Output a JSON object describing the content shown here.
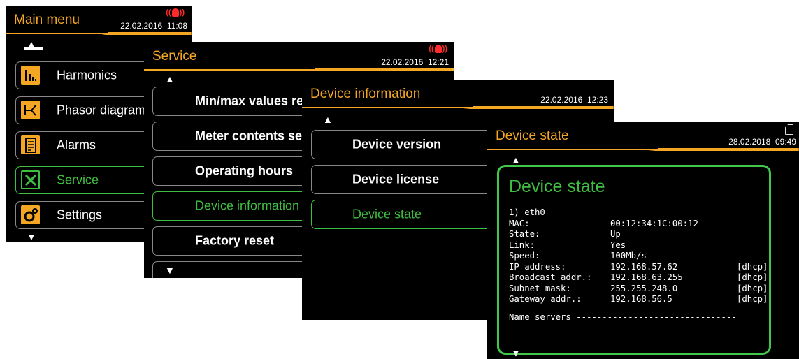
{
  "main_menu": {
    "title": "Main menu",
    "date": "22.02.2016",
    "time": "11:08",
    "up_arrow": "▲",
    "down_arrow": "▼",
    "items": [
      {
        "label": "Harmonics",
        "icon": "harmonics-icon"
      },
      {
        "label": "Phasor diagram",
        "icon": "phasor-icon"
      },
      {
        "label": "Alarms",
        "icon": "alarms-icon"
      },
      {
        "label": "Service",
        "icon": "service-icon",
        "active": true
      },
      {
        "label": "Settings",
        "icon": "settings-icon"
      }
    ]
  },
  "service": {
    "title": "Service",
    "date": "22.02.2016",
    "time": "12:21",
    "up_arrow": "▲",
    "down_arrow": "▼",
    "items": [
      {
        "label": "Min/max values reset"
      },
      {
        "label": "Meter contents settings"
      },
      {
        "label": "Operating hours"
      },
      {
        "label": "Device information",
        "active": true
      },
      {
        "label": "Factory reset"
      }
    ]
  },
  "device_information": {
    "title": "Device information",
    "date": "22.02.2016",
    "time": "12:23",
    "up_arrow": "▲",
    "items": [
      {
        "label": "Device version"
      },
      {
        "label": "Device license"
      },
      {
        "label": "Device state",
        "active": true
      }
    ]
  },
  "device_state": {
    "title": "Device state",
    "date": "28.02.2018",
    "time": "09:49",
    "up_arrow": "▲",
    "down_arrow": "▼",
    "panel_title": "Device state",
    "interface": "1) eth0",
    "rows": [
      {
        "label": "MAC:",
        "value": "00:12:34:1C:00:12",
        "tag": ""
      },
      {
        "label": "State:",
        "value": "Up",
        "tag": ""
      },
      {
        "label": "Link:",
        "value": "Yes",
        "tag": ""
      },
      {
        "label": "Speed:",
        "value": "100Mb/s",
        "tag": ""
      },
      {
        "label": "IP address:",
        "value": "192.168.57.62",
        "tag": "[dhcp]"
      },
      {
        "label": "Broadcast addr.:",
        "value": "192.168.63.255",
        "tag": "[dhcp]"
      },
      {
        "label": "Subnet mask:",
        "value": "255.255.248.0",
        "tag": "[dhcp]"
      },
      {
        "label": "Gateway addr.:",
        "value": "192.168.56.5",
        "tag": "[dhcp]"
      }
    ],
    "name_servers": "Name servers -------------------------------"
  },
  "colors": {
    "accent": "#f5a623",
    "active": "#3fbf3f",
    "alarm": "#ff2a2a",
    "background": "#000000"
  }
}
